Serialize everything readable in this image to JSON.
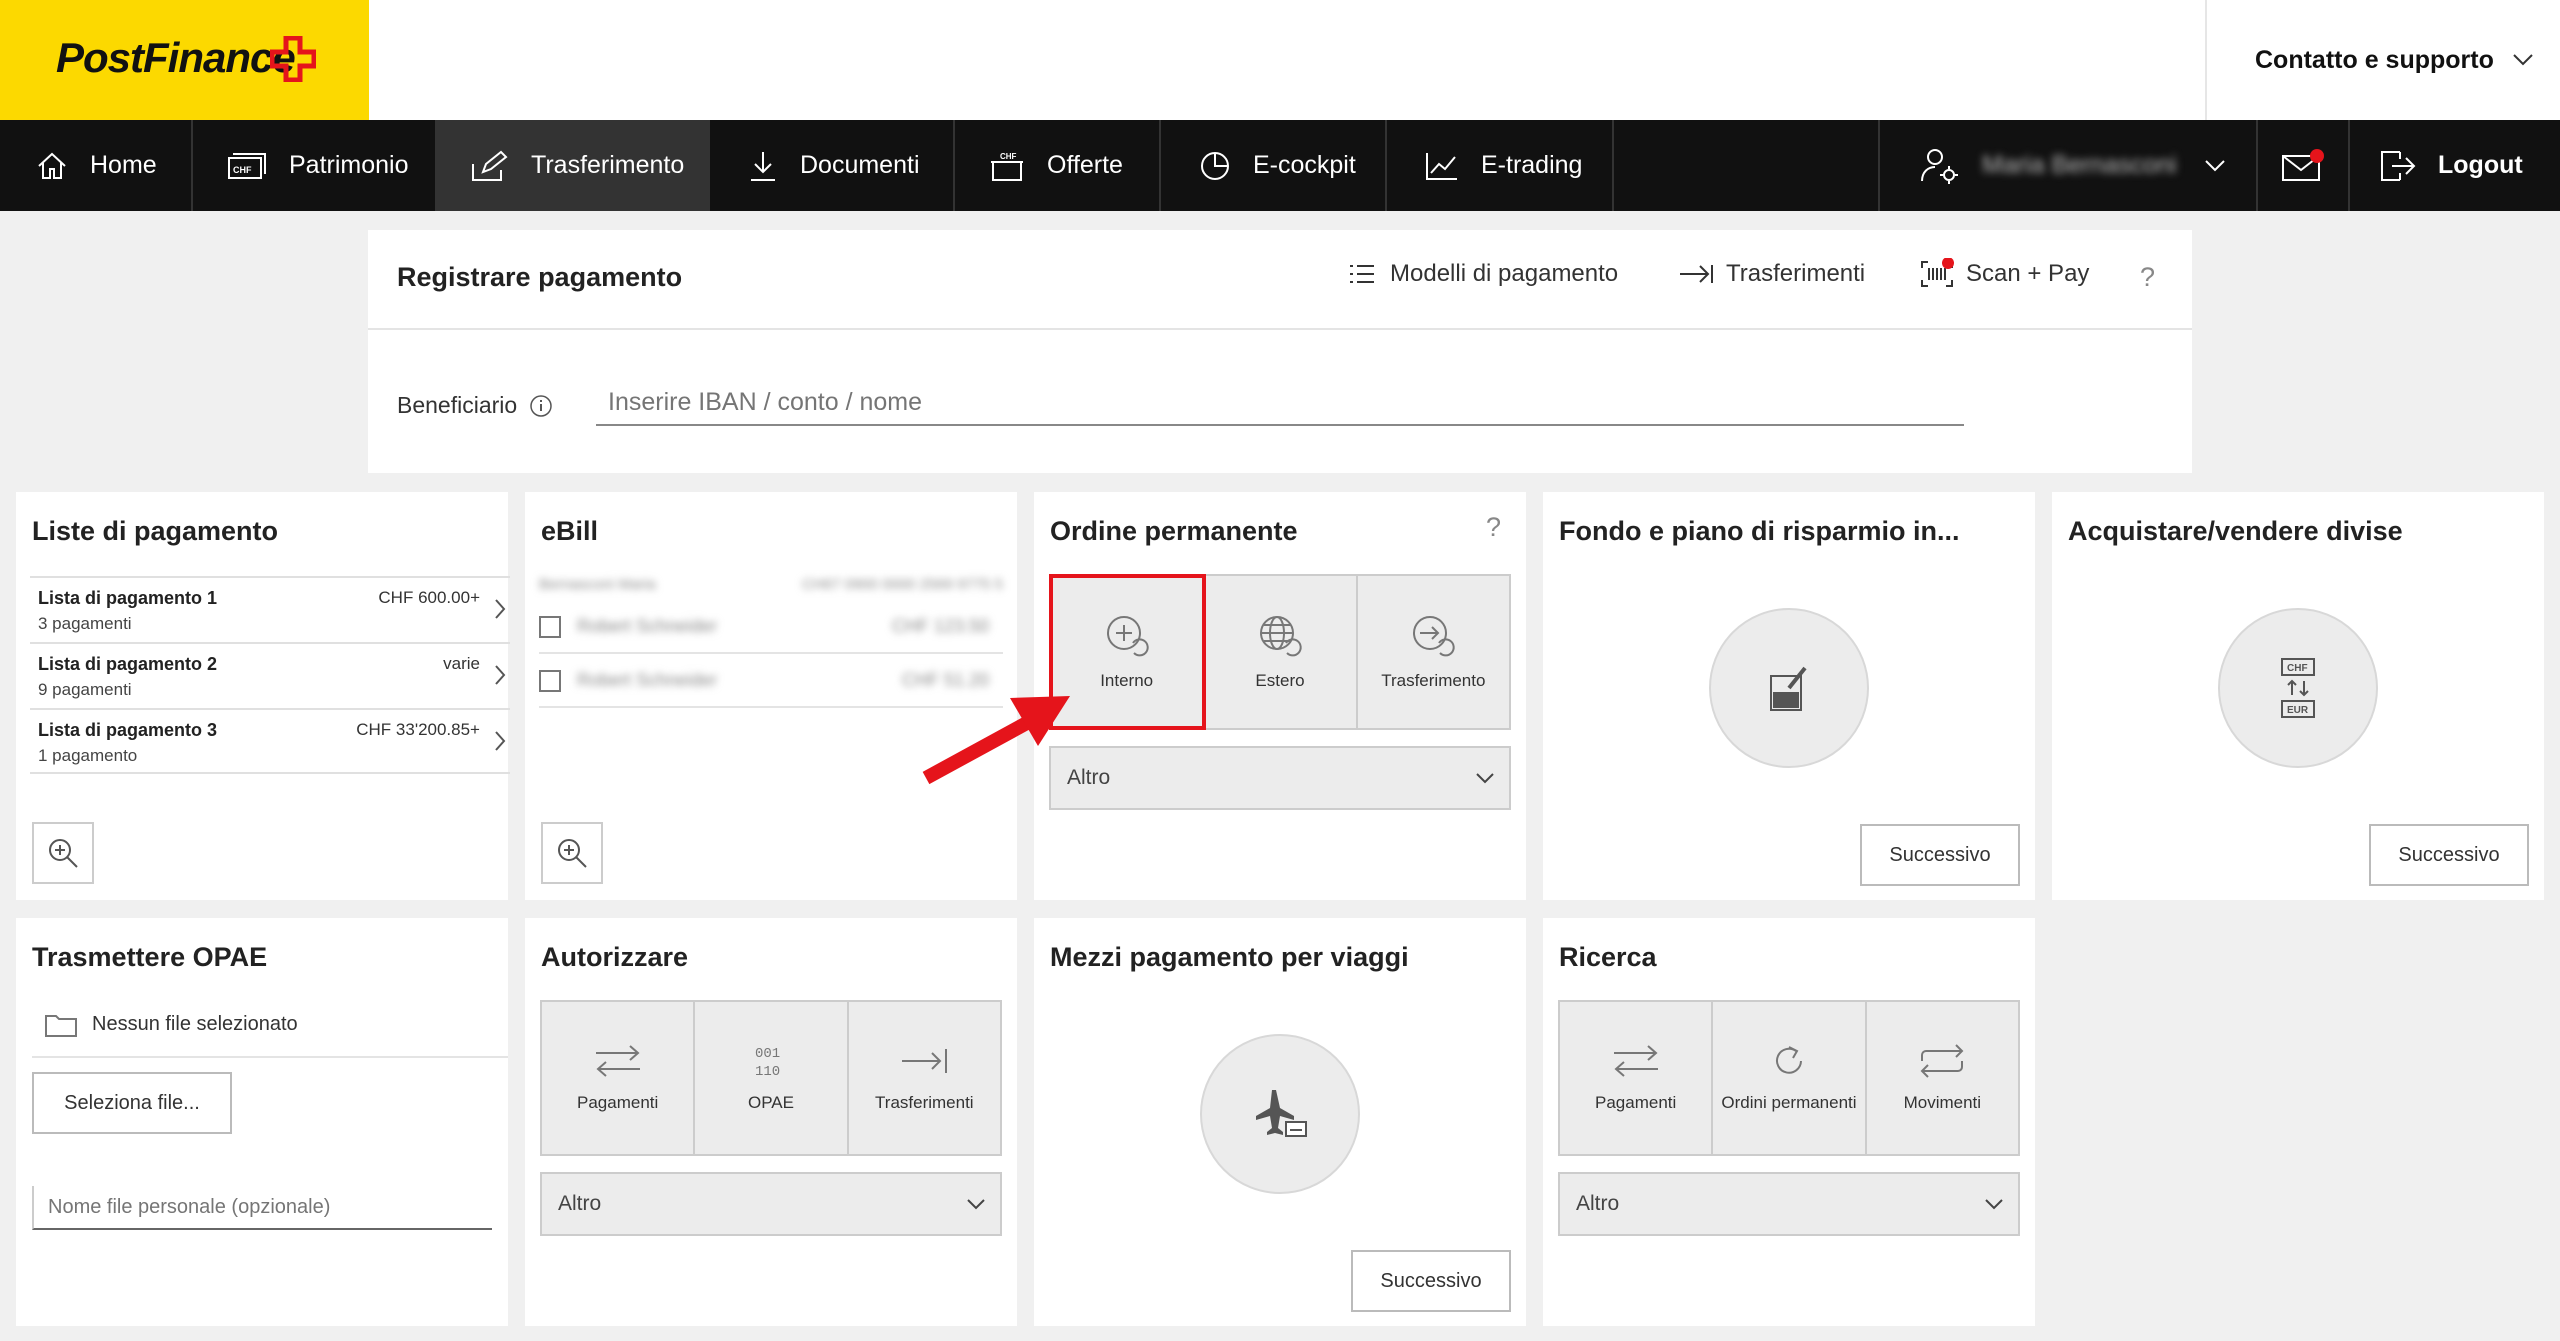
{
  "header": {
    "brand": "PostFinance",
    "contact_label": "Contatto e supporto"
  },
  "nav": {
    "items": [
      {
        "label": "Home",
        "icon": "home-icon"
      },
      {
        "label": "Patrimonio",
        "icon": "chf-wallet-icon"
      },
      {
        "label": "Trasferimento",
        "icon": "pen-icon"
      },
      {
        "label": "Documenti",
        "icon": "download-icon"
      },
      {
        "label": "Offerte",
        "icon": "offer-icon"
      },
      {
        "label": "E-cockpit",
        "icon": "pie-chart-icon"
      },
      {
        "label": "E-trading",
        "icon": "line-chart-icon"
      }
    ],
    "active": "Trasferimento",
    "user_name": "Maria Bernasconi",
    "logout_label": "Logout"
  },
  "payment": {
    "title": "Registrare pagamento",
    "templates_label": "Modelli di pagamento",
    "transfers_label": "Trasferimenti",
    "scan_label": "Scan + Pay",
    "help": "?",
    "beneficiary_label": "Beneficiario",
    "beneficiary_placeholder": "Inserire IBAN / conto / nome"
  },
  "payment_lists": {
    "title": "Liste di pagamento",
    "rows": [
      {
        "name": "Lista di pagamento 1",
        "count": "3 pagamenti",
        "amount": "CHF 600.00+"
      },
      {
        "name": "Lista di pagamento 2",
        "count": "9 pagamenti",
        "amount": "varie"
      },
      {
        "name": "Lista di pagamento 3",
        "count": "1 pagamento",
        "amount": "CHF 33'200.85+"
      }
    ]
  },
  "ebill": {
    "title": "eBill",
    "header_name": "Bernasconi Maria",
    "header_number": "CH67 0900 0000 2569 9775 5",
    "rows": [
      {
        "name": "Robert Schneider",
        "amount": "CHF 123.50"
      },
      {
        "name": "Robert Schneider",
        "amount": "CHF 51.20"
      }
    ]
  },
  "standing_order": {
    "title": "Ordine permanente",
    "help": "?",
    "tiles": [
      "Interno",
      "Estero",
      "Trasferimento"
    ],
    "select_value": "Altro"
  },
  "fund": {
    "title": "Fondo e piano di risparmio in...",
    "button": "Successivo"
  },
  "currency": {
    "title": "Acquistare/vendere divise",
    "button": "Successivo",
    "icon_top": "CHF",
    "icon_bottom": "EUR"
  },
  "opae": {
    "title": "Trasmettere OPAE",
    "no_file": "Nessun file selezionato",
    "select_button": "Seleziona file...",
    "name_placeholder": "Nome file personale (opzionale)"
  },
  "authorize": {
    "title": "Autorizzare",
    "tiles": [
      "Pagamenti",
      "OPAE",
      "Trasferimenti"
    ],
    "opae_icon_top": "001",
    "opae_icon_bottom": "110",
    "select_value": "Altro"
  },
  "travel": {
    "title": "Mezzi pagamento per viaggi",
    "button": "Successivo"
  },
  "search": {
    "title": "Ricerca",
    "tiles": [
      "Pagamenti",
      "Ordini permanenti",
      "Movimenti"
    ],
    "select_value": "Altro"
  },
  "colors": {
    "brand_yellow": "#fcd900",
    "nav_bg": "#111111",
    "highlight": "#e5141b"
  }
}
